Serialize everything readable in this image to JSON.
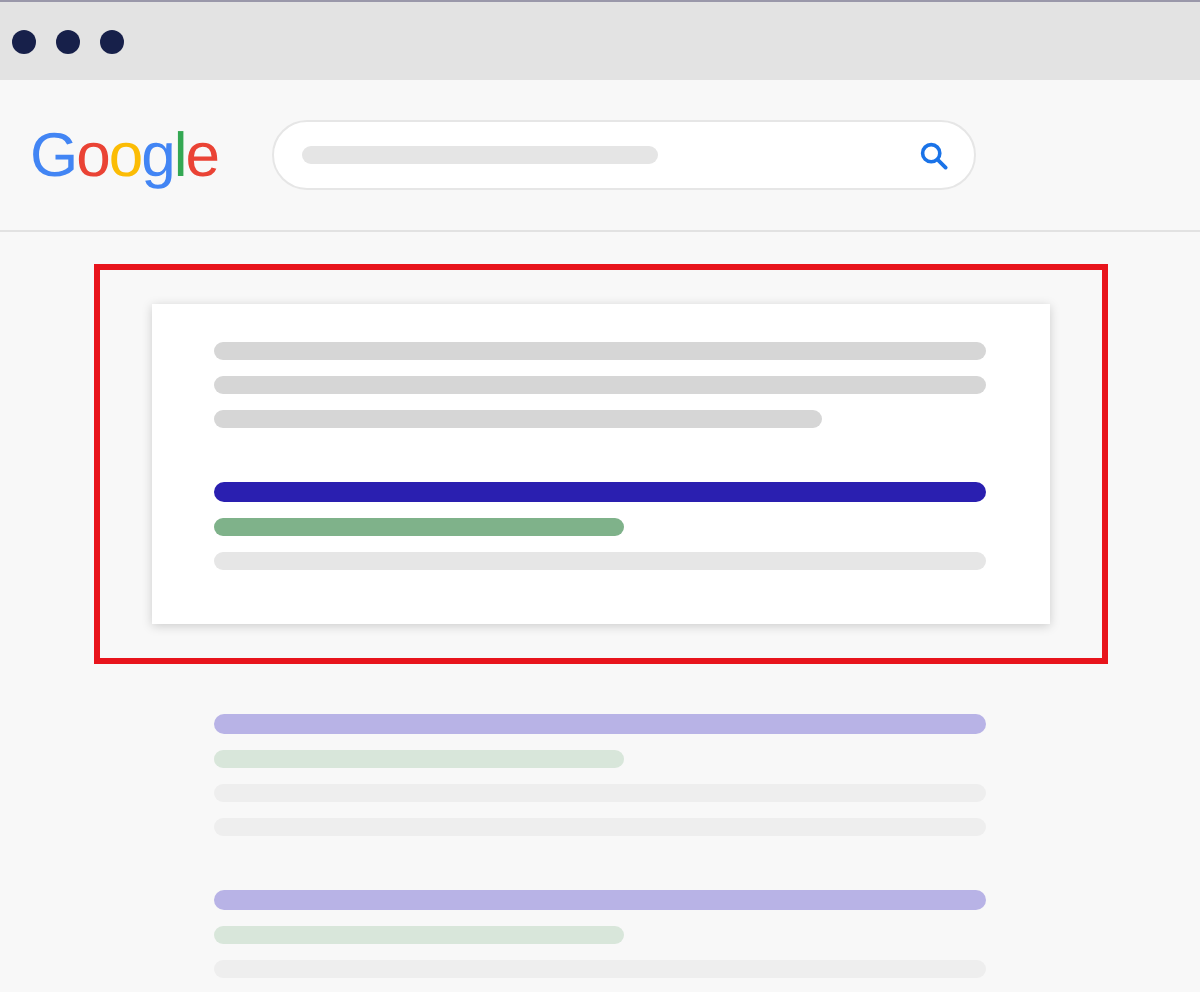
{
  "logo": {
    "text": "Google"
  },
  "results": [
    {
      "featured": true,
      "lines": [
        {
          "kind": "text"
        },
        {
          "kind": "text"
        },
        {
          "kind": "text-short"
        },
        {
          "kind": "title"
        },
        {
          "kind": "url"
        },
        {
          "kind": "snippet"
        }
      ]
    },
    {
      "featured": false,
      "lines": [
        {
          "kind": "title"
        },
        {
          "kind": "url"
        },
        {
          "kind": "snippet"
        },
        {
          "kind": "snippet"
        }
      ]
    },
    {
      "featured": false,
      "lines": [
        {
          "kind": "title"
        },
        {
          "kind": "url"
        },
        {
          "kind": "snippet"
        }
      ]
    }
  ]
}
